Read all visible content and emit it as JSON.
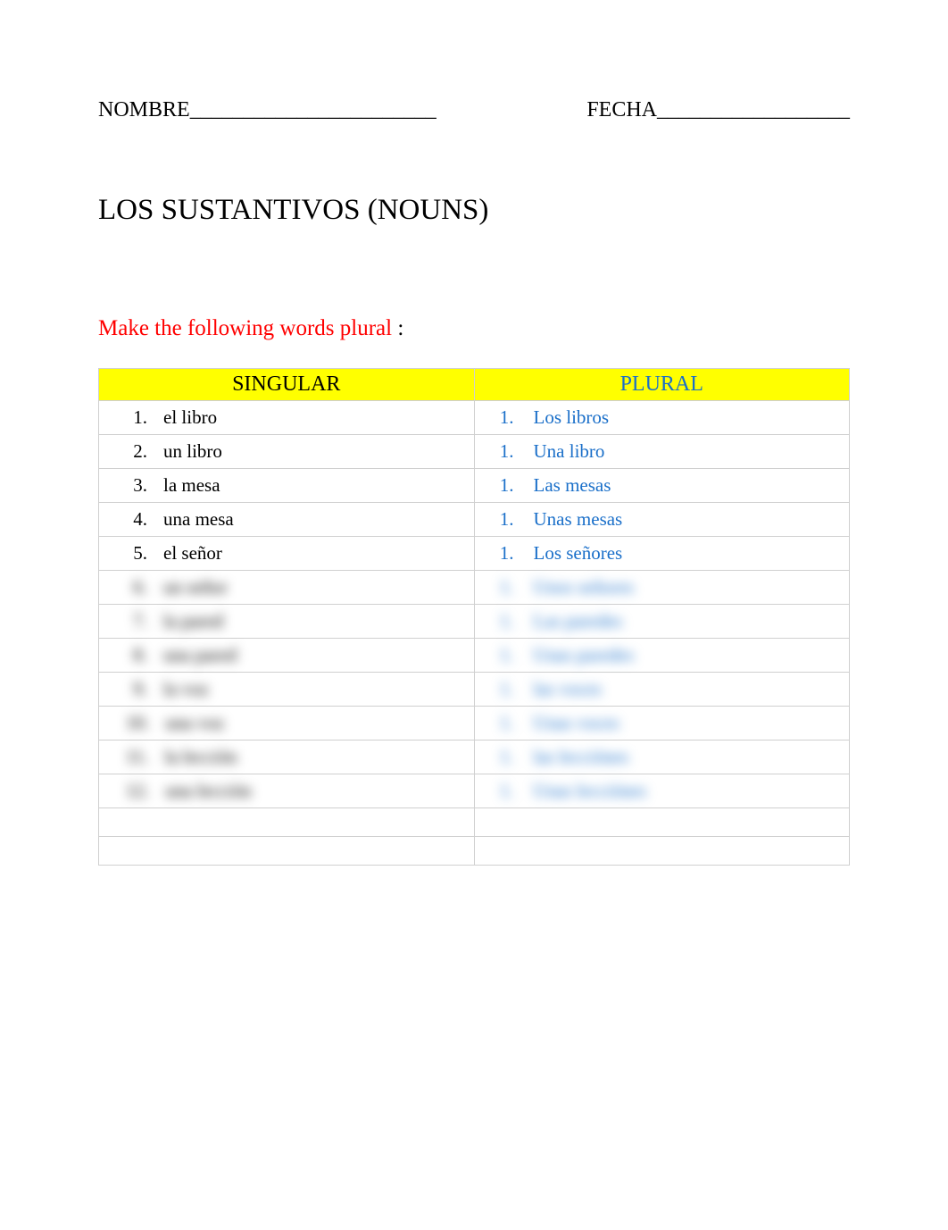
{
  "header": {
    "nombre_label": "NOMBRE",
    "nombre_blank": " _______________________",
    "fecha_label": "FECHA",
    "fecha_blank": " __________________"
  },
  "title": "LOS SUSTANTIVOS (NOUNS)",
  "instruction": "Make the following words plural",
  "instruction_colon": "   :",
  "table": {
    "singular_header": "SINGULAR",
    "plural_header": "PLURAL",
    "rows": [
      {
        "snum": "1.",
        "stext": "el libro",
        "pnum": "1.",
        "ptext": "Los libros",
        "blur": false
      },
      {
        "snum": "2.",
        "stext": "un libro",
        "pnum": "1.",
        "ptext": "Una libro",
        "blur": false
      },
      {
        "snum": "3.",
        "stext": "la mesa",
        "pnum": "1.",
        "ptext": "Las mesas",
        "blur": false
      },
      {
        "snum": "4.",
        "stext": "una mesa",
        "pnum": "1.",
        "ptext": "Unas mesas",
        "blur": false
      },
      {
        "snum": "5.",
        "stext": "el señor",
        "pnum": "1.",
        "ptext": "Los señores",
        "blur": false
      },
      {
        "snum": "6.",
        "stext": "un señor",
        "pnum": "1.",
        "ptext": "Unos señores",
        "blur": true
      },
      {
        "snum": "7.",
        "stext": "la pared",
        "pnum": "1.",
        "ptext": "Las paredes",
        "blur": true
      },
      {
        "snum": "8.",
        "stext": "una pared",
        "pnum": "1.",
        "ptext": "Unas paredes",
        "blur": true
      },
      {
        "snum": "9.",
        "stext": "la voz",
        "pnum": "1.",
        "ptext": "las voces",
        "blur": true
      },
      {
        "snum": "10.",
        "stext": "una voz",
        "pnum": "1.",
        "ptext": "Unas voces",
        "blur": true
      },
      {
        "snum": "11.",
        "stext": "la lección",
        "pnum": "1.",
        "ptext": "las lecciónes",
        "blur": true
      },
      {
        "snum": "12.",
        "stext": "una lección",
        "pnum": "1.",
        "ptext": "Unas lecciónes",
        "blur": true
      }
    ]
  }
}
